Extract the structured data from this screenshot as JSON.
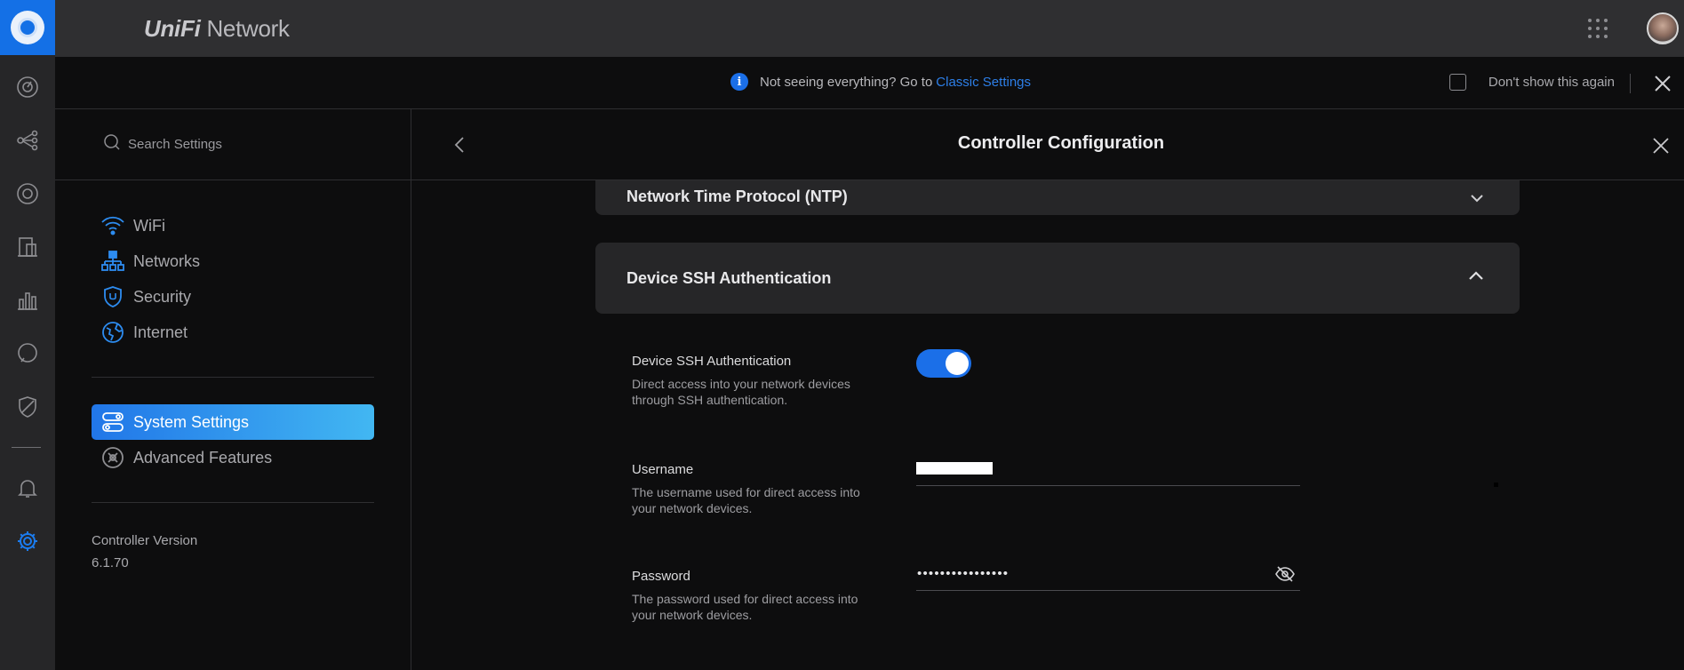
{
  "app": {
    "brand_prefix": "UniFi",
    "brand_name": "Network"
  },
  "notice": {
    "text": "Not seeing everything? Go to",
    "link": "Classic Settings",
    "dont_show": "Don't show this again"
  },
  "sidebar": {
    "search_placeholder": "Search Settings",
    "items": [
      {
        "label": "WiFi",
        "icon": "wifi-icon"
      },
      {
        "label": "Networks",
        "icon": "networks-icon"
      },
      {
        "label": "Security",
        "icon": "shield-icon"
      },
      {
        "label": "Internet",
        "icon": "globe-icon"
      },
      {
        "label": "System Settings",
        "icon": "toggles-icon",
        "active": true
      },
      {
        "label": "Advanced Features",
        "icon": "tools-icon"
      }
    ],
    "version_label": "Controller Version",
    "version_value": "6.1.70"
  },
  "main": {
    "title": "Controller Configuration",
    "sections": [
      {
        "title": "Network Time Protocol (NTP)",
        "expanded": false
      },
      {
        "title": "Device SSH Authentication",
        "expanded": true
      }
    ],
    "ssh": {
      "toggle_label": "Device SSH Authentication",
      "toggle_help": "Direct access into your network devices through SSH authentication.",
      "toggle_on": true,
      "username_label": "Username",
      "username_help": "The username used for direct access into your network devices.",
      "username_value": "",
      "password_label": "Password",
      "password_help": "The password used for direct access into your network devices.",
      "password_mask": "••••••••••••••••"
    }
  },
  "colors": {
    "accent": "#1b6fe8",
    "active_gradient_start": "#2176e8",
    "active_gradient_end": "#42b7f2",
    "link": "#2d7fe8"
  }
}
